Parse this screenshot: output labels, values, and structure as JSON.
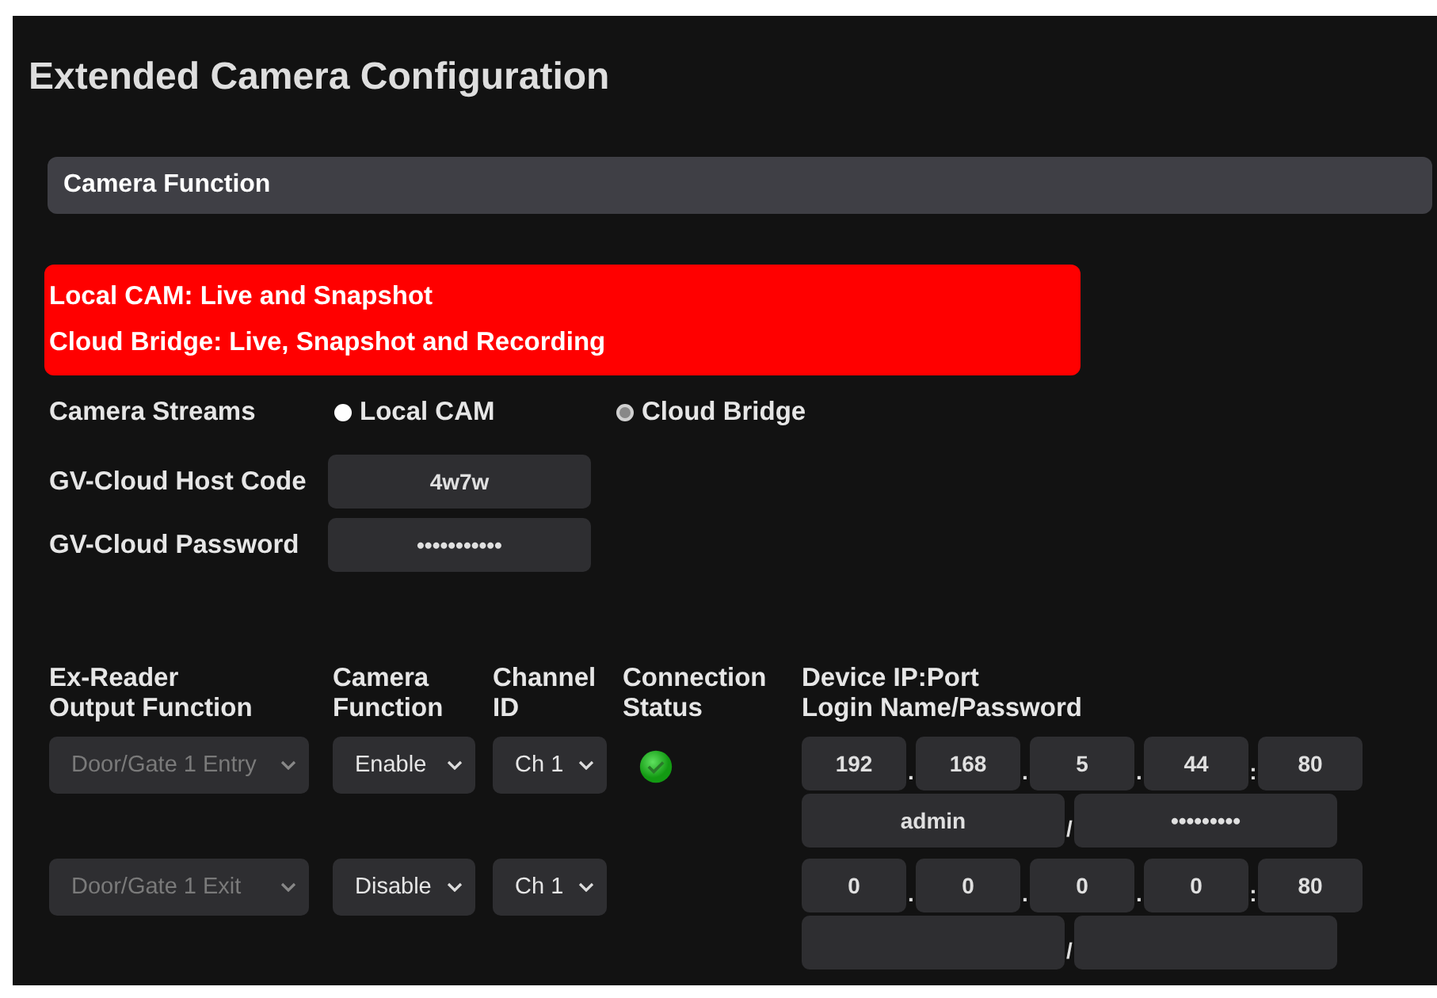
{
  "title": "Extended Camera Configuration",
  "section": "Camera Function",
  "notice": [
    "Local CAM: Live and Snapshot",
    "Cloud Bridge: Live, Snapshot and Recording"
  ],
  "streams": {
    "label": "Camera Streams",
    "options": [
      {
        "label": "Local CAM",
        "selected": false
      },
      {
        "label": "Cloud Bridge",
        "selected": true
      }
    ]
  },
  "cloud_fields": [
    {
      "label": "GV-Cloud Host Code",
      "value": "4w7w"
    },
    {
      "label": "GV-Cloud Password",
      "value": "•••••••••••"
    }
  ],
  "columns": [
    [
      "Ex-Reader",
      "Output Function"
    ],
    [
      "Camera",
      "Function"
    ],
    [
      "Channel",
      "ID"
    ],
    [
      "Connection",
      "Status"
    ],
    [
      "Device IP:Port",
      "Login Name/Password"
    ]
  ],
  "rows": [
    {
      "output": "Door/Gate 1 Entry",
      "output_disabled": true,
      "camera_function": "Enable",
      "channel": "Ch 1",
      "connected": true,
      "ip": [
        "192",
        "168",
        "5",
        "44"
      ],
      "ip_separators": [
        ".",
        ".",
        "."
      ],
      "port_separator": ":",
      "port": "80",
      "login": "admin",
      "login_separator": "/",
      "password": "•••••••••"
    },
    {
      "output": "Door/Gate 1 Exit",
      "output_disabled": true,
      "camera_function": "Disable",
      "channel": "Ch 1",
      "ip": [
        "0",
        "0",
        "0",
        "0"
      ],
      "ip_separators": [
        ".",
        ".",
        "."
      ],
      "port_separator": ":",
      "port": "80",
      "login": "",
      "login_separator": "/",
      "password": ""
    }
  ]
}
